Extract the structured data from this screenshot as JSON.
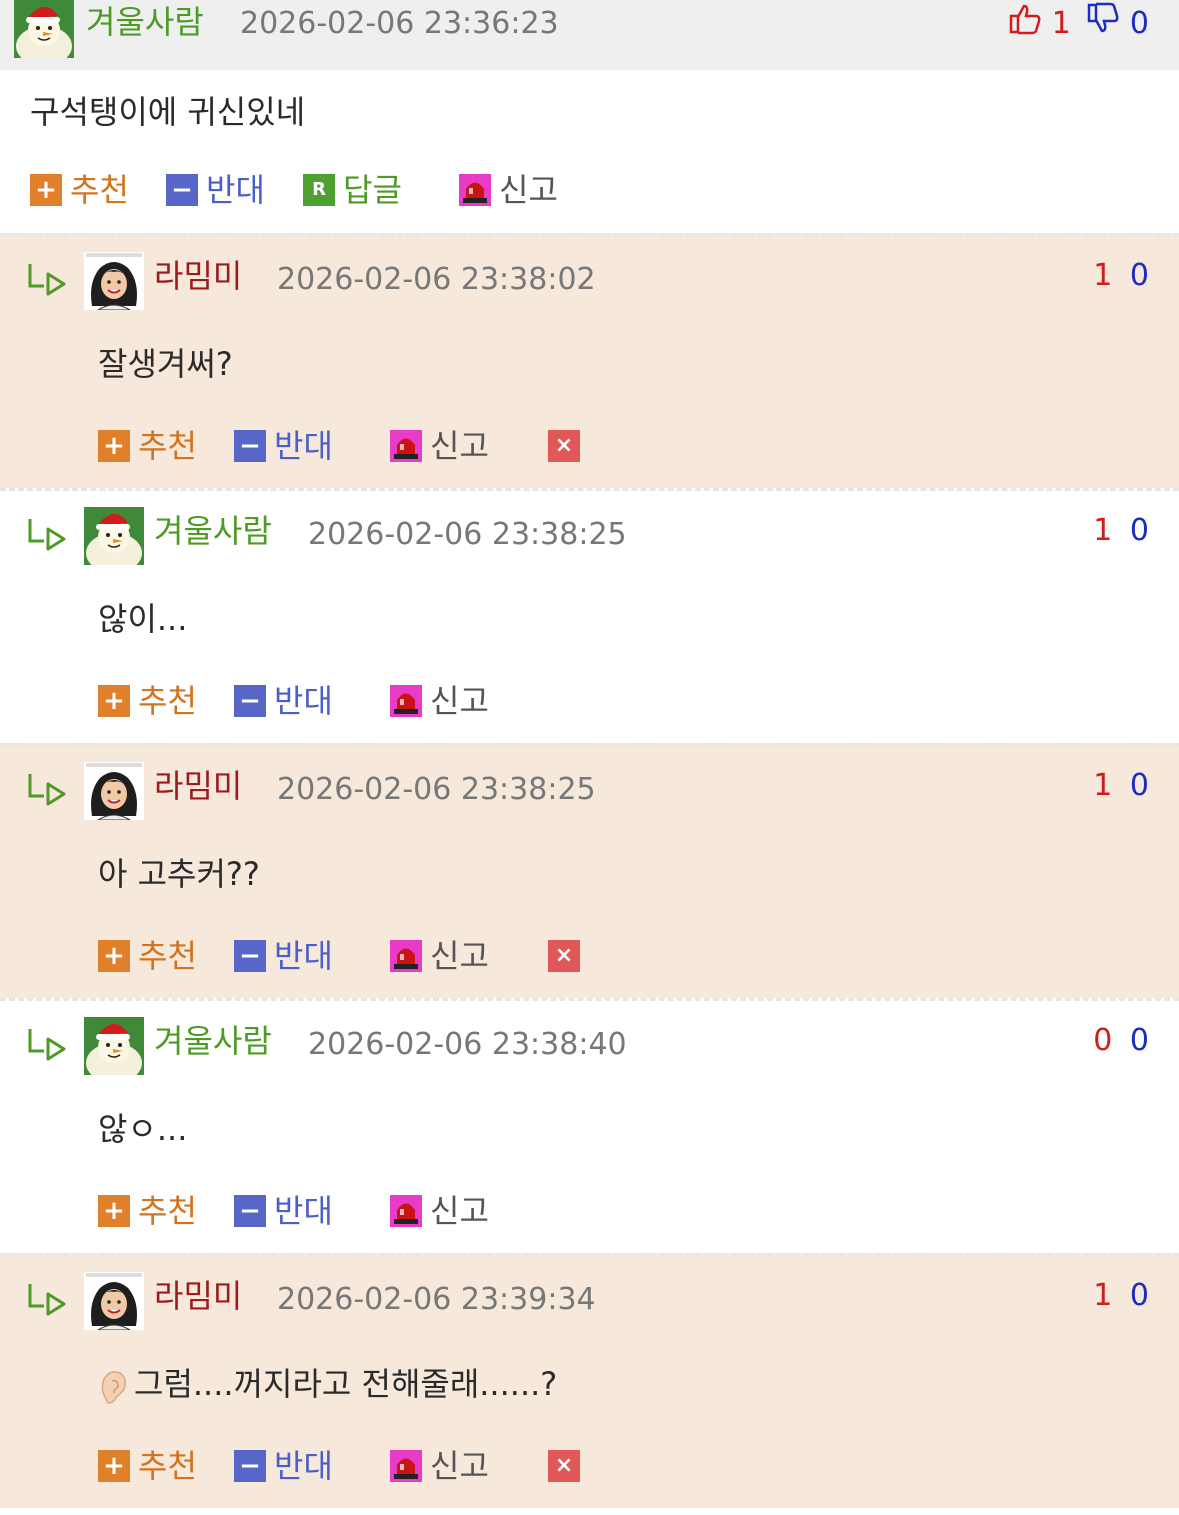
{
  "main": {
    "nickname": "겨울사람",
    "date": "2026-02-06 23:36:23",
    "up": "1",
    "down": "0",
    "text": "구석탱이에 귀신있네",
    "actions": {
      "recommend": "추천",
      "oppose": "반대",
      "reply": "답글",
      "report": "신고"
    }
  },
  "replies": [
    {
      "nickname": "라밈미",
      "date": "2026-02-06 23:38:02",
      "up": "1",
      "down": "0",
      "text": "잘생겨써?"
    },
    {
      "nickname": "겨울사람",
      "date": "2026-02-06 23:38:25",
      "up": "1",
      "down": "0",
      "text": "않이..."
    },
    {
      "nickname": "라밈미",
      "date": "2026-02-06 23:38:25",
      "up": "1",
      "down": "0",
      "text": "아 고추커??"
    },
    {
      "nickname": "겨울사람",
      "date": "2026-02-06 23:38:40",
      "up": "0",
      "down": "0",
      "text": "않ㅇ..."
    },
    {
      "nickname": "라밈미",
      "date": "2026-02-06 23:39:34",
      "up": "1",
      "down": "0",
      "text": "그럼....꺼지라고 전해줄래......?"
    }
  ],
  "reply_actions": {
    "recommend": "추천",
    "oppose": "반대",
    "report": "신고"
  },
  "colors": {
    "header_bg": "#efefef",
    "tan_bg": "#f6e8da",
    "nick_green": "#4d9a24",
    "nick_red": "#9b1c1c",
    "up": "#d21b1b",
    "down": "#1c2bc0"
  }
}
